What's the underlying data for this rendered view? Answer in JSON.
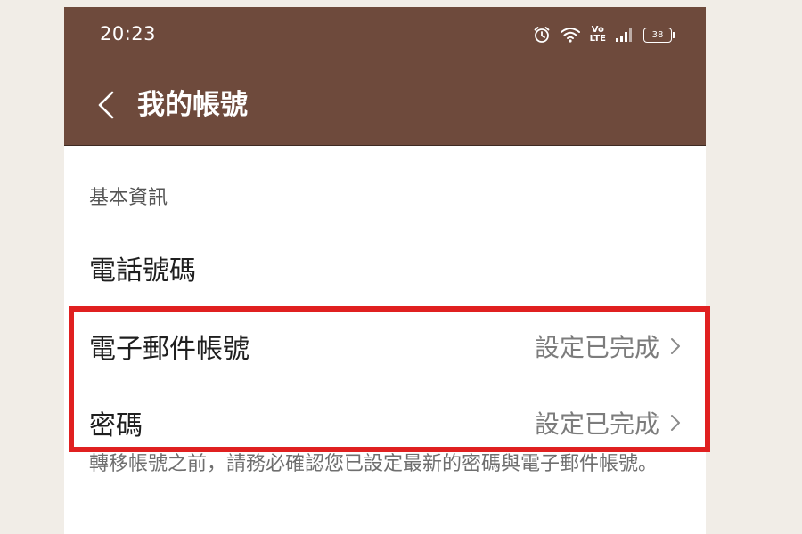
{
  "status_bar": {
    "time": "20:23",
    "lte_top": "Vo",
    "lte_bottom": "LTE",
    "battery": "38",
    "icons": [
      "alarm-icon",
      "wifi-icon",
      "signal-icon",
      "battery-icon"
    ]
  },
  "app_bar": {
    "title": "我的帳號",
    "back_icon": "chevron-left-icon",
    "background_color": "#6e4a3c"
  },
  "section": {
    "header": "基本資訊",
    "rows": [
      {
        "label": "電話號碼",
        "value": ""
      },
      {
        "label": "電子郵件帳號",
        "value": "設定已完成",
        "chevron": "chevron-right-icon"
      },
      {
        "label": "密碼",
        "value": "設定已完成",
        "chevron": "chevron-right-icon"
      }
    ]
  },
  "note": "轉移帳號之前，請務必確認您已設定最新的密碼與電子郵件帳號。",
  "annotation": {
    "highlight_color": "#e02020"
  }
}
